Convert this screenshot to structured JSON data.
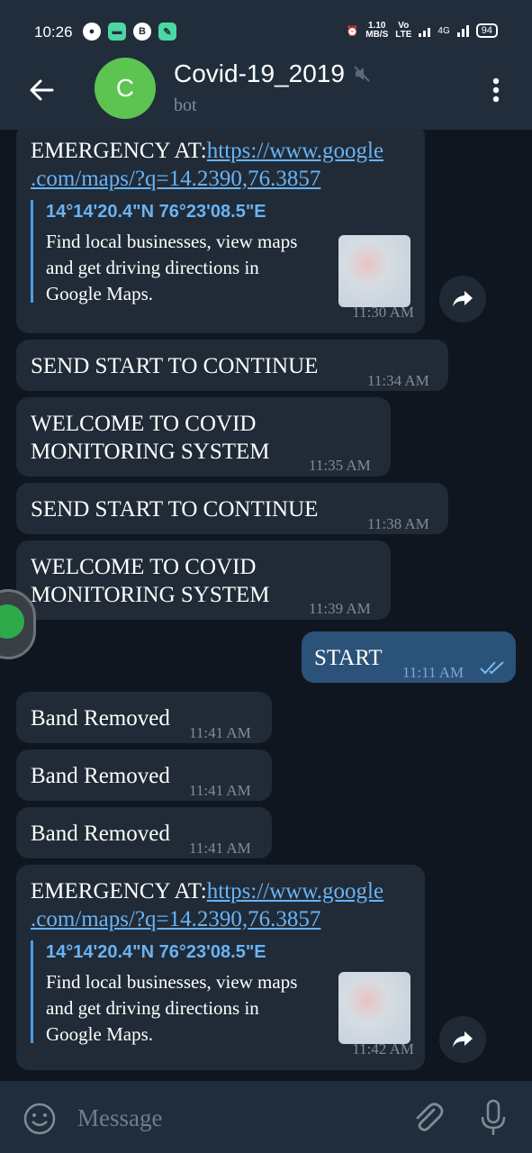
{
  "status": {
    "time": "10:26",
    "speed": "1.10",
    "speed_unit": "MB/S",
    "net1": "Vo",
    "net2": "LTE",
    "net3": "4G",
    "battery": "94"
  },
  "header": {
    "avatar_letter": "C",
    "title": "Covid-19_2019",
    "subtitle": "bot"
  },
  "messages": {
    "m1_prefix": "EMERGENCY  AT:",
    "m1_link": "https://www.google.com/maps/?q=14.2390,76.3857",
    "m1_link_a": "https://www.google",
    "m1_link_b": ".com/maps/?q=14.2390,76.3857",
    "m1_pv_title": "14°14'20.4\"N 76°23'08.5\"E",
    "m1_pv_desc1": "Find local businesses, view maps",
    "m1_pv_desc2": "and get driving directions in",
    "m1_pv_desc3": "Google Maps.",
    "m1_time": "11:30 AM",
    "m2_text": "SEND START TO CONTINUE",
    "m2_time": "11:34 AM",
    "m3_line1": "WELCOME TO COVID",
    "m3_line2": "MONITORING SYSTEM",
    "m3_time": "11:35 AM",
    "m4_text": "SEND START TO CONTINUE",
    "m4_time": "11:38 AM",
    "m5_line1": "WELCOME TO COVID",
    "m5_line2": "MONITORING SYSTEM",
    "m5_time": "11:39 AM",
    "m6_text": "START",
    "m6_time": "11:11 AM",
    "m7_text": "Band Removed",
    "m7_time": "11:41 AM",
    "m8_text": "Band Removed",
    "m8_time": "11:41 AM",
    "m9_text": "Band Removed",
    "m9_time": "11:41 AM",
    "m10_prefix": "EMERGENCY  AT:",
    "m10_link_a": "https://www.google",
    "m10_link_b": ".com/maps/?q=14.2390,76.3857",
    "m10_pv_title": "14°14'20.4\"N 76°23'08.5\"E",
    "m10_pv_desc1": "Find local businesses, view maps",
    "m10_pv_desc2": "and get driving directions in",
    "m10_pv_desc3": "Google Maps.",
    "m10_time": "11:42 AM"
  },
  "input": {
    "placeholder": "Message"
  },
  "colors": {
    "background": "#0f161f",
    "bar": "#212d3b",
    "incoming": "#202b37",
    "outgoing": "#2b5278",
    "link": "#6ab3f3",
    "avatar": "#5dc452"
  },
  "icons": [
    "back-arrow-icon",
    "mute-icon",
    "more-vert-icon",
    "share-icon",
    "double-check-icon",
    "emoji-icon",
    "attach-icon",
    "mic-icon"
  ]
}
